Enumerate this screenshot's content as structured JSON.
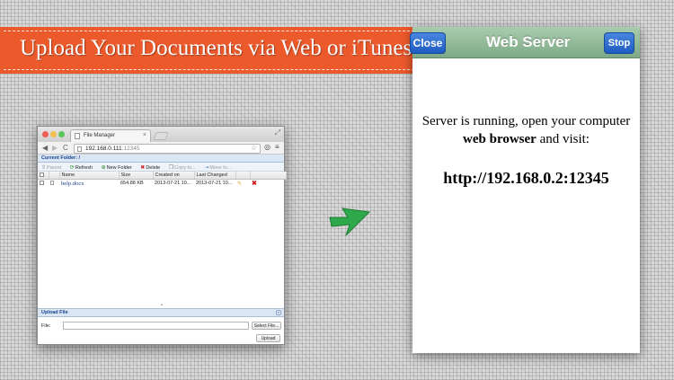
{
  "banner": {
    "text": "Upload Your Documents via Web or iTunes",
    "color": "#ec5a2c"
  },
  "browser": {
    "tab_title": "File Manager",
    "url_host": "192.168.0.111",
    "url_port": ":12345",
    "current_folder": "Current Folder: /",
    "actions": {
      "parent": "Parent",
      "refresh": "Refresh",
      "new_folder": "New Folder",
      "delete": "Delete",
      "copy": "Copy to...",
      "move": "Move to..."
    },
    "columns": [
      "Name",
      "Size",
      "Created on",
      "Last Changed"
    ],
    "rows": [
      {
        "name": "help.docx",
        "size": "654.88 KB",
        "created": "2013-07-21 10...",
        "changed": "2013-07-21 10..."
      }
    ],
    "upload": {
      "title": "Upload File",
      "file_label": "File:",
      "select_label": "Select File...",
      "upload_label": "Upload"
    }
  },
  "phone": {
    "close_label": "Close",
    "title": "Web Server",
    "stop_label": "Stop",
    "message_line1": "Server is running, open your computer",
    "message_bold": "web browser",
    "message_line2_rest": " and visit:",
    "url": "http://192.168.0.2:12345",
    "nav_color": "#8fb896",
    "button_color": "#2a6fd6"
  },
  "arrow": {
    "color": "#2ea84a"
  }
}
